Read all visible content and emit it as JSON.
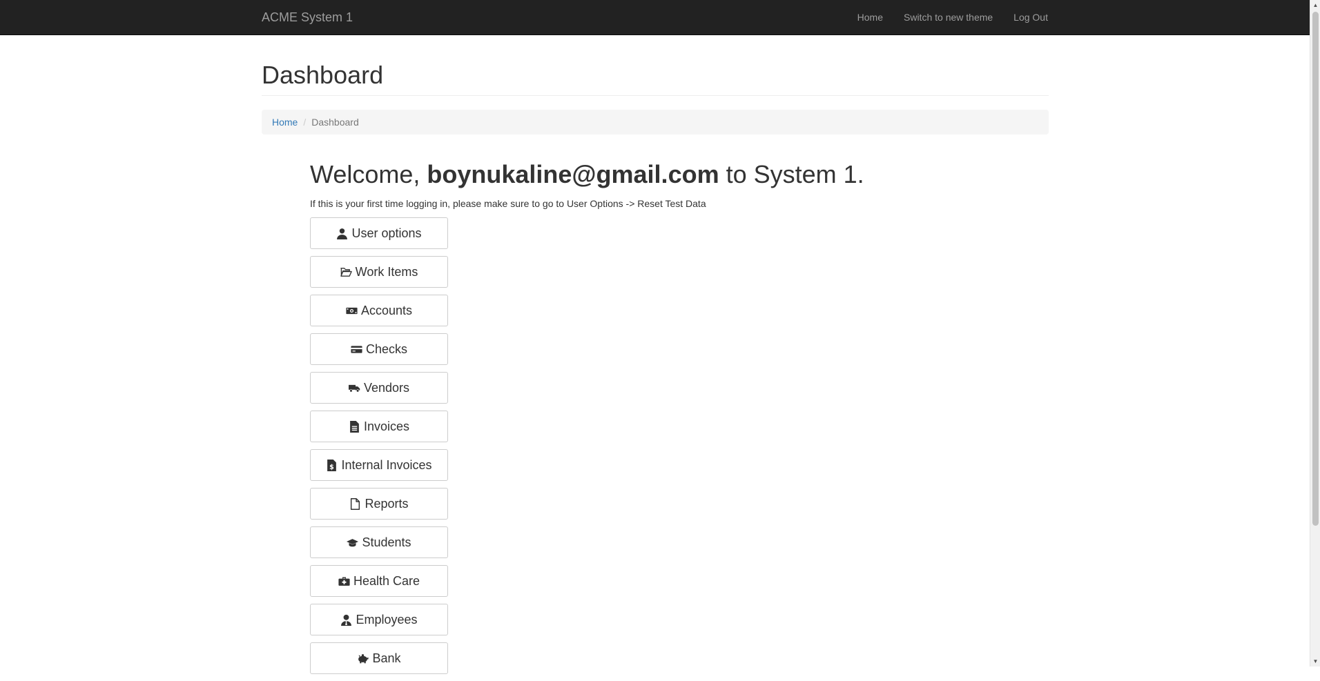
{
  "navbar": {
    "brand": "ACME System 1",
    "links": [
      {
        "label": "Home"
      },
      {
        "label": "Switch to new theme"
      },
      {
        "label": "Log Out"
      }
    ]
  },
  "page": {
    "title": "Dashboard"
  },
  "breadcrumb": {
    "home": "Home",
    "separator": "/",
    "current": "Dashboard"
  },
  "welcome": {
    "prefix": "Welcome, ",
    "email": "boynukaline@gmail.com",
    "suffix": " to System 1.",
    "notice": "If this is your first time logging in, please make sure to go to User Options -> Reset Test Data"
  },
  "menu": [
    {
      "label": "User options",
      "icon": "user-icon"
    },
    {
      "label": "Work Items",
      "icon": "folder-open-icon"
    },
    {
      "label": "Accounts",
      "icon": "money-bill-icon"
    },
    {
      "label": "Checks",
      "icon": "credit-card-icon"
    },
    {
      "label": "Vendors",
      "icon": "truck-icon"
    },
    {
      "label": "Invoices",
      "icon": "file-text-icon"
    },
    {
      "label": "Internal Invoices",
      "icon": "file-invoice-dollar-icon"
    },
    {
      "label": "Reports",
      "icon": "file-icon"
    },
    {
      "label": "Students",
      "icon": "graduation-cap-icon"
    },
    {
      "label": "Health Care",
      "icon": "medkit-icon"
    },
    {
      "label": "Employees",
      "icon": "user-tie-icon"
    },
    {
      "label": "Bank",
      "icon": "piggy-bank-icon"
    }
  ],
  "colors": {
    "navbar_bg": "#222222",
    "nav_text": "#9d9d9d",
    "link": "#337ab7",
    "breadcrumb_bg": "#f5f5f5"
  }
}
